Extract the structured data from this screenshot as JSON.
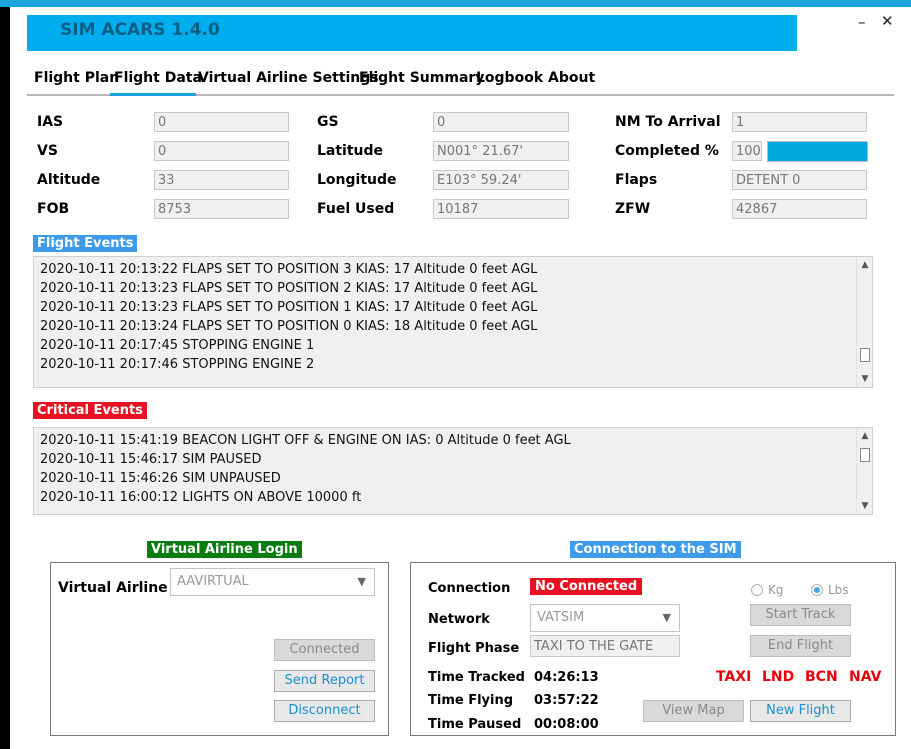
{
  "app": {
    "title": "SIM ACARS  1.4.0",
    "minimize_glyph": "–",
    "close_glyph": "✕"
  },
  "tabs": [
    {
      "label": "Flight Plan"
    },
    {
      "label": "Flight Data",
      "active": true
    },
    {
      "label": "Virtual Airline Settings"
    },
    {
      "label": "Flight Summary"
    },
    {
      "label": "Logbook"
    },
    {
      "label": "About"
    }
  ],
  "flight_data": {
    "ias": {
      "label": "IAS",
      "value": "0"
    },
    "vs": {
      "label": "VS",
      "value": "0"
    },
    "altitude": {
      "label": "Altitude",
      "value": "33"
    },
    "fob": {
      "label": "FOB",
      "value": "8753"
    },
    "gs": {
      "label": "GS",
      "value": "0"
    },
    "latitude": {
      "label": "Latitude",
      "value": "N001° 21.67'"
    },
    "longitude": {
      "label": "Longitude",
      "value": "E103° 59.24'"
    },
    "fuel_used": {
      "label": "Fuel Used",
      "value": "10187"
    },
    "nm_to_arrival": {
      "label": "NM To Arrival",
      "value": "1"
    },
    "completed": {
      "label": "Completed  %",
      "value": "100",
      "progress": 1.0,
      "bar_color": "#00a8e0"
    },
    "flaps": {
      "label": "Flaps",
      "value": "DETENT 0"
    },
    "zfw": {
      "label": "ZFW",
      "value": "42867"
    }
  },
  "flight_events": {
    "title": "Flight Events",
    "color": "#3d9be9",
    "lines": [
      "2020-10-11 20:13:22 FLAPS SET TO POSITION 3  KIAS: 17 Altitude 0 feet AGL",
      "2020-10-11 20:13:23 FLAPS SET TO POSITION 2  KIAS: 17 Altitude 0 feet AGL",
      "2020-10-11 20:13:23 FLAPS SET TO POSITION 1  KIAS: 17 Altitude 0 feet AGL",
      "2020-10-11 20:13:24 FLAPS SET TO POSITION 0  KIAS: 18 Altitude 0 feet AGL",
      "2020-10-11 20:17:45 STOPPING ENGINE 1",
      "2020-10-11 20:17:46 STOPPING ENGINE 2"
    ]
  },
  "critical_events": {
    "title": "Critical Events",
    "color": "#e81123",
    "lines": [
      "2020-10-11 15:41:19 BEACON LIGHT OFF & ENGINE ON  IAS: 0 Altitude 0 feet AGL",
      "2020-10-11 15:46:17 SIM PAUSED",
      "2020-10-11 15:46:26 SIM UNPAUSED",
      "2020-10-11 16:00:12 LIGHTS ON ABOVE 10000 ft"
    ]
  },
  "va_login": {
    "title": "Virtual Airline Login",
    "color": "#0a7d12",
    "airline_label": "Virtual Airline",
    "airline_value": "AAVIRTUAL",
    "connected_button": "Connected",
    "send_report_button": "Send Report",
    "disconnect_button": "Disconnect"
  },
  "sim_connection": {
    "title": "Connection to the SIM",
    "color": "#3d9be9",
    "connection_label": "Connection",
    "connection_status": "No Connected",
    "status_color": "#e81123",
    "network_label": "Network",
    "network_value": "VATSIM",
    "phase_label": "Flight Phase",
    "phase_value": "TAXI TO THE GATE",
    "time_tracked_label": "Time Tracked",
    "time_tracked": "04:26:13",
    "time_flying_label": "Time Flying",
    "time_flying": "03:57:22",
    "time_paused_label": "Time Paused",
    "time_paused": "00:08:00",
    "unit_kg": "Kg",
    "unit_lbs": "Lbs",
    "selected_unit": "Lbs",
    "start_track_button": "Start Track",
    "end_flight_button": "End Flight",
    "view_map_button": "View Map",
    "new_flight_button": "New Flight",
    "indicators": [
      "TAXI",
      "LND",
      "BCN",
      "NAV"
    ]
  }
}
